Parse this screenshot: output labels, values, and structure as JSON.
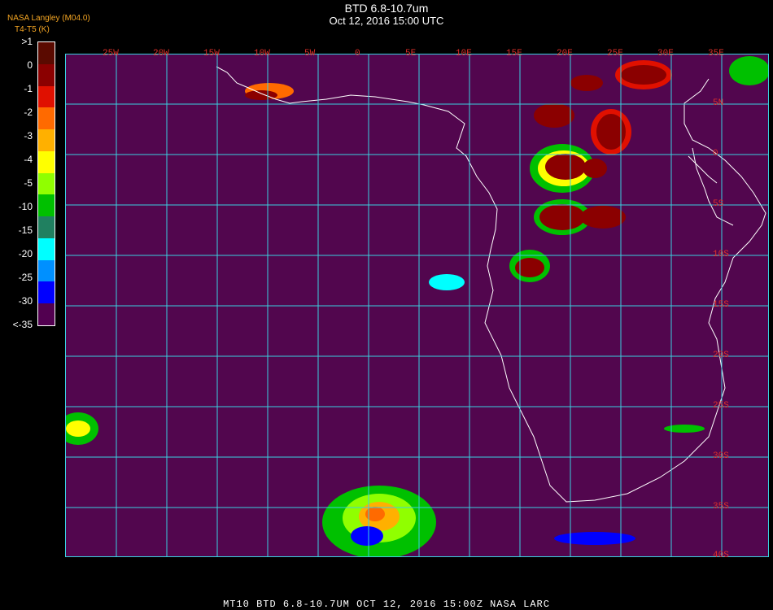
{
  "header": {
    "title": "BTD 6.8-10.7um",
    "datetime": "Oct 12, 2016 15:00 UTC",
    "credit": "NASA Langley (M04.0)",
    "units": "T4-T5 (K)"
  },
  "colorbar": {
    "labels": [
      ">1",
      "0",
      "-1",
      "-2",
      "-3",
      "-4",
      "-5",
      "-10",
      "-15",
      "-20",
      "-25",
      "-30",
      "<-35"
    ],
    "colors": [
      "#5a0a00",
      "#8b0000",
      "#e01000",
      "#ff6a00",
      "#ffb000",
      "#ffff00",
      "#90ff00",
      "#00c000",
      "#208060",
      "#00ffff",
      "#0090ff",
      "#0000ff",
      "#520050"
    ]
  },
  "map": {
    "background": "#52064e",
    "grid_color": "#3ad0e0",
    "coastline_color": "#ffffff",
    "lon_labels": [
      "25W",
      "20W",
      "15W",
      "10W",
      "5W",
      "0",
      "5E",
      "10E",
      "15E",
      "20E",
      "25E",
      "30E",
      "35E"
    ],
    "lat_labels": [
      "5N",
      "0",
      "5S",
      "10S",
      "15S",
      "20S",
      "25S",
      "30S",
      "35S",
      "40S"
    ]
  },
  "footer": "MT10  BTD 6.8-10.7UM   OCT 12, 2016 15:00Z   NASA LARC"
}
